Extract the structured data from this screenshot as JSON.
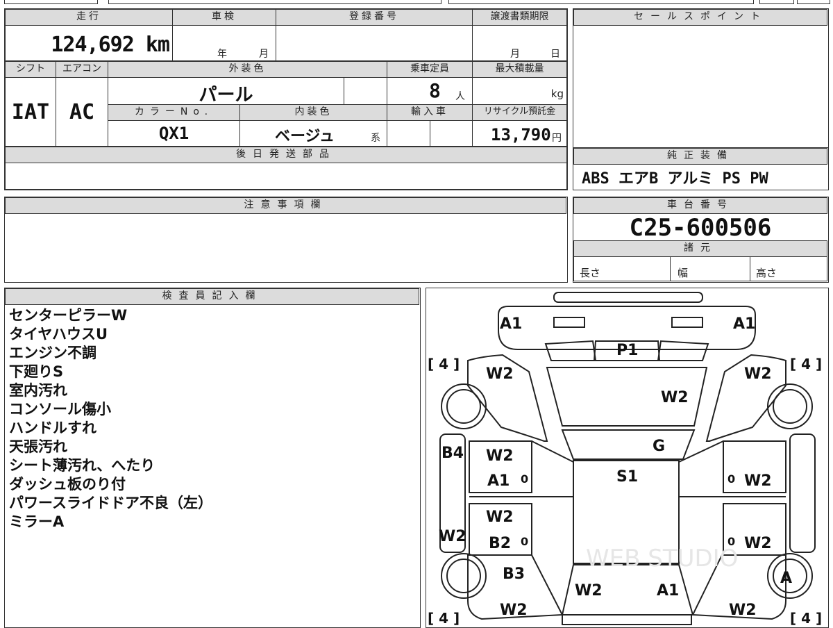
{
  "sheet": {
    "mileage_label": "走行",
    "mileage_value": "124,692 km",
    "shaken_label": "車検",
    "shaken_year": "年",
    "shaken_month": "月",
    "registration_label": "登録番号",
    "transfer_deadline_label": "譲渡書類期限",
    "transfer_month": "月",
    "transfer_day": "日",
    "shift_label": "シフト",
    "shift_value": "IAT",
    "ac_label": "エアコン",
    "ac_value": "AC",
    "exterior_color_label": "外装色",
    "exterior_color_value": "パール",
    "capacity_label": "乗車定員",
    "capacity_value": "8",
    "capacity_unit": "人",
    "max_load_label": "最大積載量",
    "max_load_unit": "kg",
    "color_no_label": "カラーNo.",
    "color_no_value": "QX1",
    "interior_color_label": "内装色",
    "interior_color_value": "ベージュ",
    "interior_color_suffix": "系",
    "import_label": "輸入車",
    "recycle_label": "リサイクル預託金",
    "recycle_value": "13,790",
    "recycle_unit": "円",
    "later_parts_label": "後日発送部品",
    "caution_label": "注意事項欄",
    "inspector_label": "検査員記入欄"
  },
  "sidebar": {
    "sales_point_label": "セールスポイント",
    "genuine_equipment_label": "純正装備",
    "genuine_equipment_value": "ABS エアB アルミ PS PW",
    "chassis_label": "車台番号",
    "chassis_value": "C25-600506",
    "specs_label": "諸元",
    "length_label": "長さ",
    "width_label": "幅",
    "height_label": "高さ"
  },
  "inspector_notes": [
    "センターピラーW",
    "タイヤハウスU",
    "エンジン不調",
    "下廻りS",
    "室内汚れ",
    "コンソール傷小",
    "ハンドルすれ",
    "天張汚れ",
    "シート薄汚れ、へたり",
    "ダッシュ板のり付",
    "パワースライドドア不良（左）",
    "ミラーA"
  ],
  "diagram": {
    "marks": {
      "front_left": "A1",
      "front_right": "A1",
      "hood": "P1",
      "front_fender_left": "W2",
      "front_fender_right": "W2",
      "windshield": "W2",
      "roof_front": "G",
      "roof": "S1",
      "front_door_left_1": "W2",
      "front_door_left_2": "A1",
      "rear_door_left_1": "W2",
      "rear_door_left_2": "B2",
      "door_right_front": "W2",
      "door_right_rear": "W2",
      "pillar_left_top": "B4",
      "pillar_left_bottom": "W2",
      "rear_left": "B3",
      "rear_quarter_left": "W2",
      "tailgate_left": "W2",
      "tailgate_right": "A1",
      "rear_quarter_right": "W2",
      "wheel_rear_right": "A",
      "front_fender_left_upper": "W2",
      "front_fender_right_upper": "W2"
    },
    "tire_tags": [
      "[ 4 ]",
      "[ 4 ]",
      "[ 4 ]",
      "[ 4 ]"
    ],
    "zero_marks": [
      "0",
      "0",
      "0",
      "0"
    ],
    "watermark": "WEB STUDIO"
  }
}
